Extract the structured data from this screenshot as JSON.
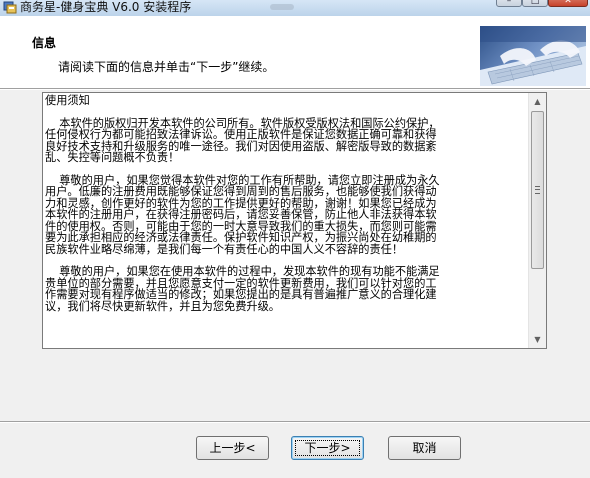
{
  "window": {
    "title": "商务星-健身宝典 V6.0 安装程序",
    "controls": {
      "minimize": "–",
      "maximize": "□",
      "close": "✕"
    }
  },
  "header": {
    "title": "信息",
    "subtitle": "请阅读下面的信息并单击“下一步”继续。",
    "image": "keyboard-hands-image"
  },
  "info": {
    "heading": "使用须知",
    "paragraphs": [
      "    本软件的版权归开发本软件的公司所有。软件版权受版权法和国际公约保护，任何侵权行为都可能招致法律诉讼。使用正版软件是保证您数据正确可靠和获得良好技术支持和升级服务的唯一途径。我们对因使用盗版、解密版导致的数据紊乱、失控等问题概不负责！",
      "    尊敬的用户，如果您觉得本软件对您的工作有所帮助，请您立即注册成为永久用户。低廉的注册费用既能够保证您得到周到的售后服务，也能够使我们获得动力和灵感，创作更好的软件为您的工作提供更好的帮助，谢谢！如果您已经成为本软件的注册用户，在获得注册密码后，请您妥善保管，防止他人非法获得本软件的使用权。否则，可能由于您的一时大意导致我们的重大损失，而您则可能需要为此承担相应的经济或法律责任。保护软件知识产权，为振兴尚处在幼稚期的民族软件业略尽绵薄，是我们每一个有责任心的中国人义不容辞的责任！",
      "    尊敬的用户，如果您在使用本软件的过程中，发现本软件的现有功能不能满足贵单位的部分需要，并且您愿意支付一定的软件更新费用，我们可以针对您的工作需要对现有程序做适当的修改；如果您提出的是具有普遍推广意义的合理化建议，我们将尽快更新软件，并且为您免费升级。"
    ]
  },
  "buttons": {
    "back": "上一步<",
    "next": "下一步>",
    "cancel": "取消"
  }
}
